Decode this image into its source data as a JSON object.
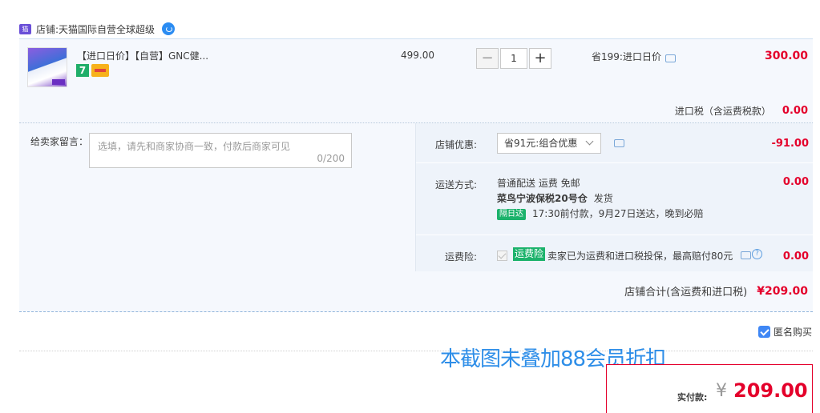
{
  "shop": {
    "prefix": "店铺:",
    "name": "天猫国际自营全球超级",
    "logo_icon": "tmall-icon",
    "contact_icon": "wangwang-chat-icon"
  },
  "item": {
    "title": "【进口日价】【自营】GNC健...",
    "badges": [
      "7",
      "card-icon"
    ],
    "unit_price": "499.00",
    "quantity": "1",
    "qty_minus": "−",
    "qty_plus": "+",
    "promo": "省199:进口日价",
    "subtotal": "300.00",
    "tax_label": "进口税（含运费税款）",
    "tax_value": "0.00"
  },
  "message": {
    "label": "给卖家留言：",
    "placeholder": "选填，请先和商家协商一致，付款后商家可见",
    "counter": "0/200"
  },
  "discount": {
    "label": "店铺优惠:",
    "selected": "省91元:组合优惠",
    "value": "-91.00"
  },
  "shipping": {
    "label": "运送方式:",
    "method": "普通配送 运费 免邮",
    "warehouse": "菜鸟宁波保税20号仓",
    "warehouse_suffix": "发货",
    "nextday_badge": "隔日达",
    "delivery_note": "17:30前付款，9月27日送达，晚到必赔",
    "value": "0.00"
  },
  "insurance": {
    "label": "运费险:",
    "tag": "运费险",
    "text": "卖家已为运费和进口税投保，最高赔付80元",
    "value": "0.00"
  },
  "shop_total": {
    "label": "店铺合计(含运费和进口税)",
    "value": "¥209.00"
  },
  "anonymous": {
    "label": "匿名购买",
    "checked": true
  },
  "overlay_note": "本截图未叠加88会员折扣",
  "payment": {
    "label": "实付款:",
    "currency": "¥",
    "amount": "209.00"
  },
  "colors": {
    "price_red": "#e4002b",
    "accent_blue": "#2e8ee8",
    "green": "#1bb26b",
    "panel_bg": "#f5f8fd"
  }
}
